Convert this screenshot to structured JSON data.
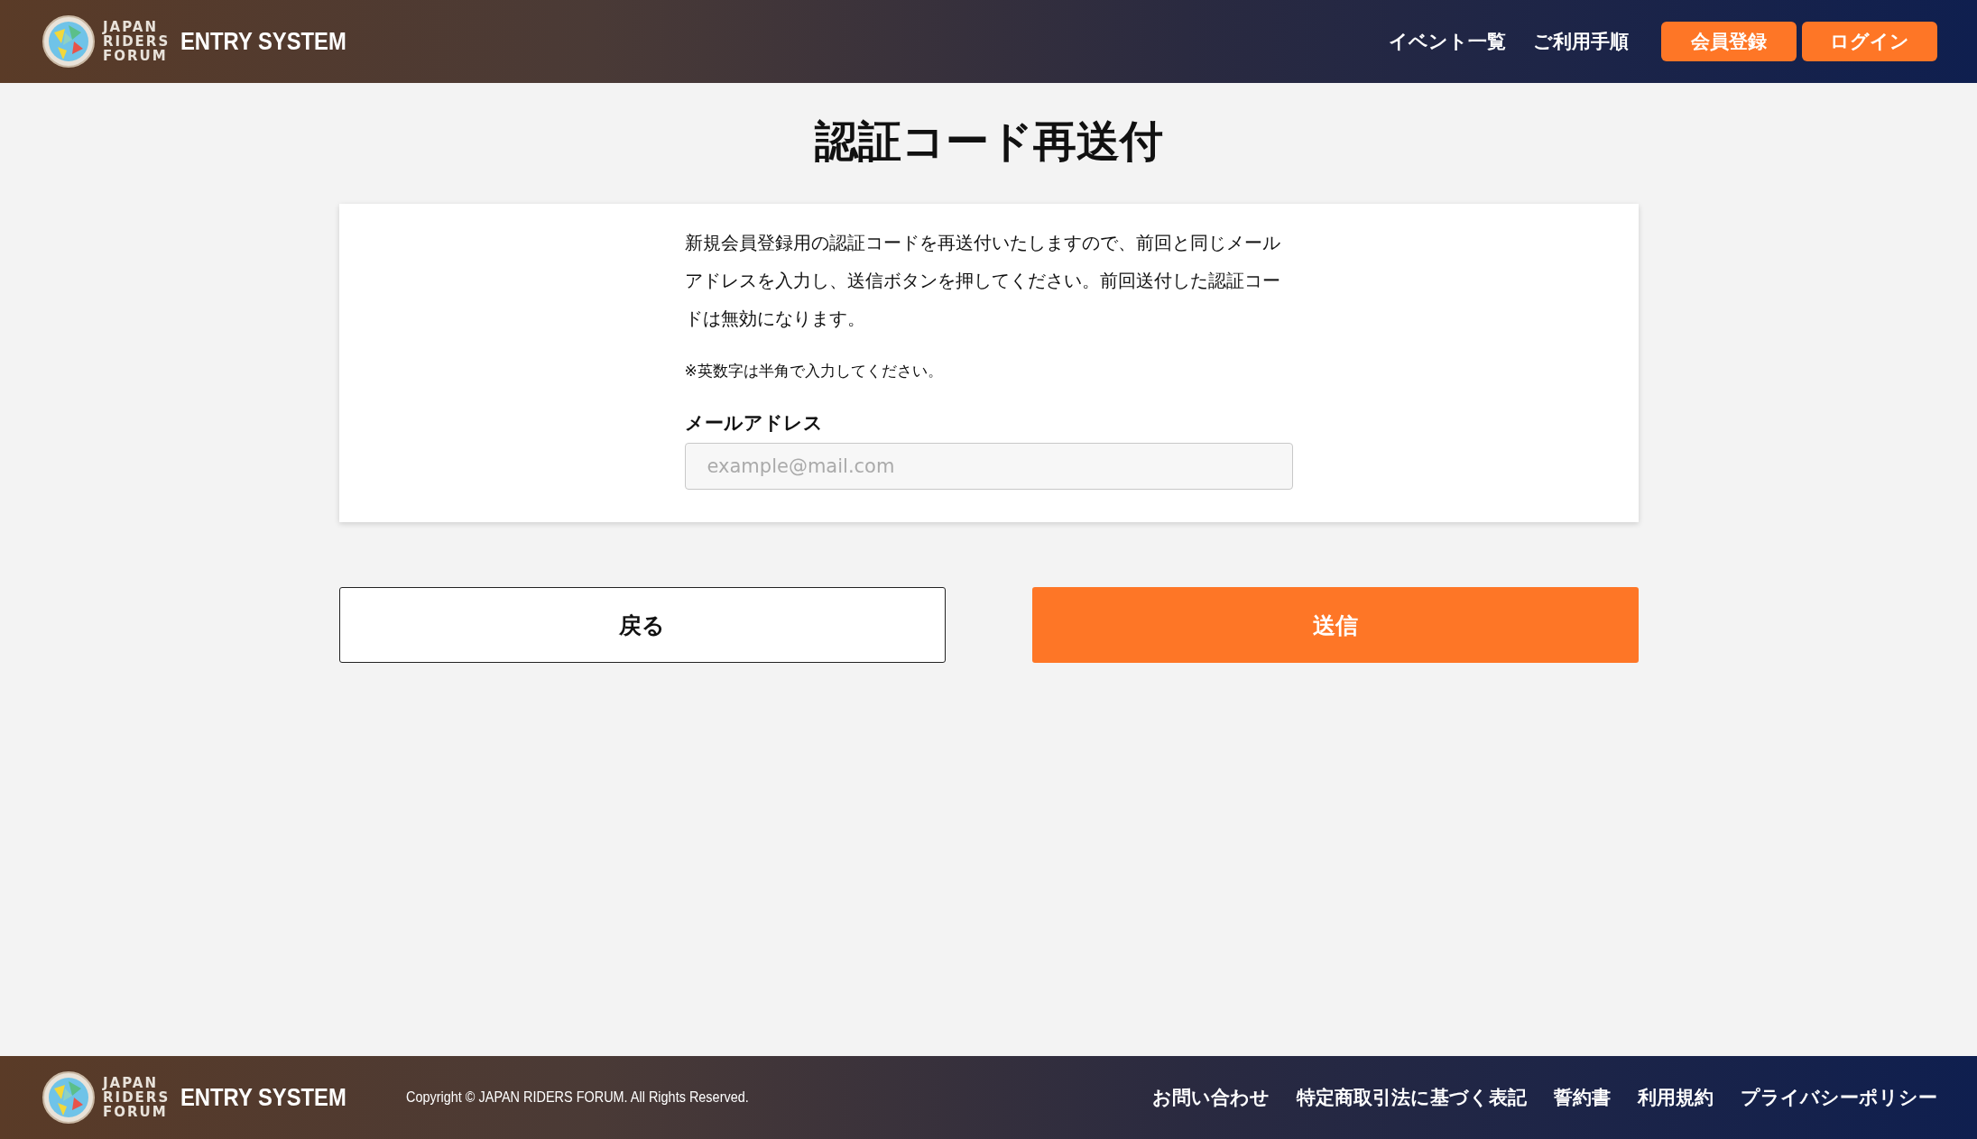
{
  "header": {
    "logo_lines": [
      "JAPAN",
      "RIDERS",
      "FORUM"
    ],
    "logo_title": "ENTRY SYSTEM",
    "nav_links": [
      "イベント一覧",
      "ご利用手順"
    ],
    "buttons": [
      "会員登録",
      "ログイン"
    ]
  },
  "page_title": "認証コード再送付",
  "card": {
    "description": "新規会員登録用の認証コードを再送付いたしますので、前回と同じメールアドレスを入力し、送信ボタンを押してください。前回送付した認証コードは無効になります。",
    "note": "※英数字は半角で入力してください。",
    "field": {
      "label": "メールアドレス",
      "placeholder": "example@mail.com"
    }
  },
  "actions": [
    {
      "label": "戻る",
      "kind": "secondary"
    },
    {
      "label": "送信",
      "kind": "primary"
    }
  ],
  "footer": {
    "logo_lines": [
      "JAPAN",
      "RIDERS",
      "FORUM"
    ],
    "logo_title": "ENTRY SYSTEM",
    "copyright": "Copyright © JAPAN RIDERS FORUM. All Rights Reserved.",
    "links": [
      "お問い合わせ",
      "特定商取引法に基づく表記",
      "誓約書",
      "利用規約",
      "プライバシーポリシー"
    ]
  }
}
